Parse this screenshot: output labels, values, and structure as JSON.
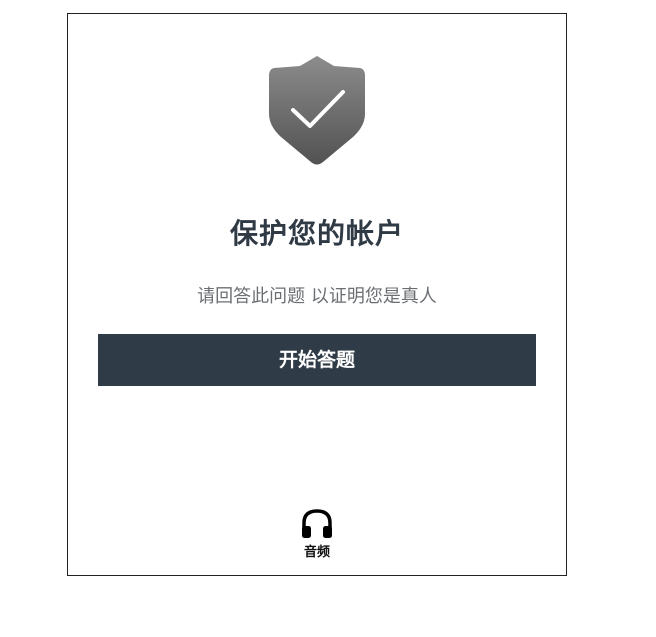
{
  "card": {
    "title": "保护您的帐户",
    "subtitle": "请回答此问题 以证明您是真人",
    "start_button_label": "开始答题",
    "audio_label": "音频"
  },
  "icons": {
    "shield": "shield-check-icon",
    "audio": "headphones-icon"
  },
  "colors": {
    "title_text": "#2f3a45",
    "button_bg": "#2f3b47",
    "button_text": "#ffffff",
    "shield_top": "#8a8a8a",
    "shield_bottom": "#555555"
  }
}
